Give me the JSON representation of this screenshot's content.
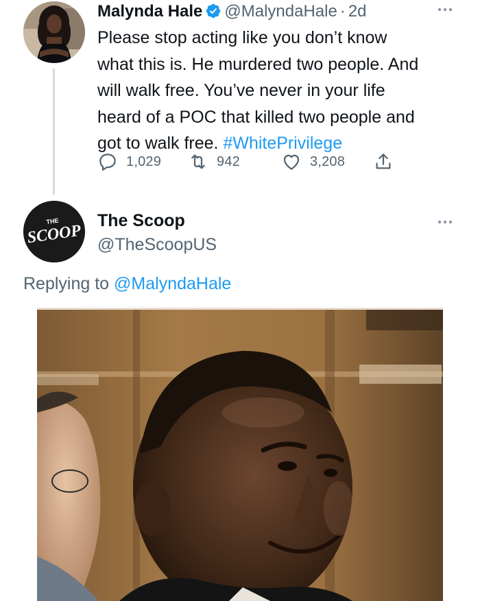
{
  "tweet1": {
    "author_name": "Malynda Hale",
    "handle": "@MalyndaHale",
    "separator": "·",
    "time": "2d",
    "lines": [
      "Please stop acting like you don’t know",
      "what this is. He murdered two people. And",
      "will walk free. You’ve never in your life",
      "heard of a POC that killed two people and",
      "got to walk free."
    ],
    "hashtag": "#WhitePrivilege",
    "replies": "1,029",
    "retweets": "942",
    "likes": "3,208",
    "icons": [
      "verified-badge-icon",
      "more-icon",
      "reply-icon",
      "retweet-icon",
      "like-icon",
      "share-icon"
    ]
  },
  "tweet2": {
    "author_name": "The Scoop",
    "handle": "@TheScoopUS",
    "avatar_logo_text_top": "THE",
    "avatar_logo_text": "SCOOP",
    "replying_prefix": "Replying to",
    "replying_to": "@MalyndaHale",
    "icons": [
      "more-icon"
    ]
  },
  "colors": {
    "text": "#0f1419",
    "secondary": "#536471",
    "link": "#1d9bf0",
    "thread_line": "#cfd9de"
  }
}
